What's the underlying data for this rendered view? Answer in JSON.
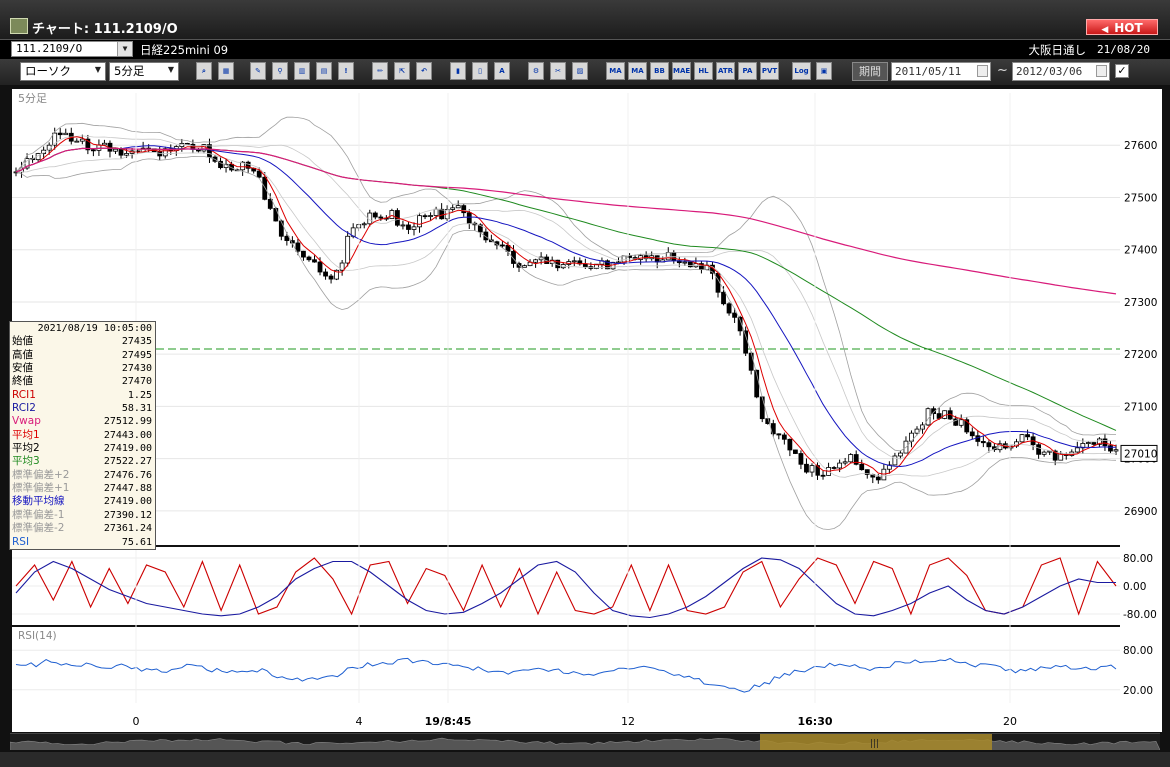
{
  "window": {
    "title": "チャート: 111.2109/O",
    "hot_label": "HOT"
  },
  "symbol": {
    "code": "111.2109/O",
    "name": "日経225mini 09",
    "exchange": "大阪日通し",
    "date": "21/08/20"
  },
  "toolbar": {
    "chart_type": "ローソク",
    "interval": "5分足",
    "icons": [
      "zoom-icon",
      "crosshair-icon",
      "draw-icon",
      "search-icon",
      "bar-chart-icon",
      "pattern-icon",
      "warning-icon",
      "pen-icon",
      "cursor-icon",
      "undo-icon",
      "candle-icon",
      "candle-icon",
      "all-icon",
      "settings-icon",
      "tools-icon",
      "color-icon"
    ],
    "indicator_buttons": [
      "MA",
      "MA",
      "BB",
      "MAE",
      "HL",
      "ATR",
      "PA",
      "PVT",
      "Log"
    ],
    "period_label": "期間",
    "date_from": "2011/05/11",
    "date_to": "2012/03/06",
    "tilde": "~"
  },
  "chart": {
    "interval_label": "5分足",
    "price_labels": [
      "27600",
      "27500",
      "27400",
      "27300",
      "27200",
      "27100",
      "27000",
      "26900"
    ],
    "current_price": "27010",
    "rci_labels": [
      "80.00",
      "0.00",
      "-80.00"
    ],
    "rsi_title": "RSI(14)",
    "rsi_labels": [
      "80.00",
      "20.00"
    ],
    "x_labels": [
      "0",
      "4",
      "19/8:45",
      "12",
      "16:30",
      "20"
    ],
    "colors": {
      "bg": "#ffffff",
      "ma_blue": "#1515c0",
      "ma_red": "#dd0000",
      "vwap": "#d81b7a",
      "ma_long": "#1f8a1f",
      "band": "#a0a0a0",
      "rsi": "#1e5fd0",
      "rci1": "#cc0000",
      "rci2": "#1a1aa0"
    }
  },
  "info_panel": {
    "datetime": "2021/08/19 10:05:00",
    "rows": [
      {
        "label": "始値",
        "value": "27435",
        "color": "#000000"
      },
      {
        "label": "高値",
        "value": "27495",
        "color": "#000000"
      },
      {
        "label": "安値",
        "value": "27430",
        "color": "#000000"
      },
      {
        "label": "終値",
        "value": "27470",
        "color": "#000000"
      },
      {
        "label": "RCI1",
        "value": "1.25",
        "color": "#cc0000"
      },
      {
        "label": "RCI2",
        "value": "58.31",
        "color": "#1a1aa0"
      },
      {
        "label": "Vwap",
        "value": "27512.99",
        "color": "#d81b7a"
      },
      {
        "label": "平均1",
        "value": "27443.00",
        "color": "#dd0000"
      },
      {
        "label": "平均2",
        "value": "27419.00",
        "color": "#000000"
      },
      {
        "label": "平均3",
        "value": "27522.27",
        "color": "#1f8a1f"
      },
      {
        "label": "標準偏差+2",
        "value": "27476.76",
        "color": "#999999"
      },
      {
        "label": "標準偏差+1",
        "value": "27447.88",
        "color": "#999999"
      },
      {
        "label": "移動平均線",
        "value": "27419.00",
        "color": "#1515c0"
      },
      {
        "label": "標準偏差-1",
        "value": "27390.12",
        "color": "#999999"
      },
      {
        "label": "標準偏差-2",
        "value": "27361.24",
        "color": "#999999"
      },
      {
        "label": "RSI",
        "value": "75.61",
        "color": "#1e5fd0"
      }
    ]
  },
  "chart_data": {
    "type": "candlestick",
    "interval": "5分足",
    "ylim": [
      26850,
      27700
    ],
    "dashed_level": 27210,
    "x_ticks": [
      "0",
      "4",
      "19/8:45",
      "12",
      "16:30",
      "20"
    ],
    "close_path": [
      27560,
      27575,
      27620,
      27610,
      27600,
      27600,
      27585,
      27585,
      27590,
      27595,
      27600,
      27550,
      27560,
      27540,
      27440,
      27400,
      27380,
      27330,
      27440,
      27460,
      27470,
      27440,
      27465,
      27470,
      27480,
      27420,
      27400,
      27370,
      27380,
      27370,
      27380,
      27370,
      27375,
      27380,
      27380,
      27390,
      27380,
      27370,
      27300,
      27230,
      27080,
      27040,
      26990,
      26970,
      26990,
      27000,
      26960,
      26990,
      27050,
      27090,
      27080,
      27060,
      27030,
      27020,
      27040,
      27010,
      27000,
      27020,
      27030,
      27010
    ],
    "rsi": {
      "name": "RSI(14)",
      "ylim": [
        0,
        100
      ],
      "values": [
        62,
        58,
        65,
        55,
        60,
        52,
        57,
        50,
        48,
        55,
        53,
        47,
        45,
        50,
        42,
        38,
        35,
        40,
        55,
        58,
        62,
        66,
        60,
        57,
        55,
        50,
        46,
        48,
        52,
        50,
        47,
        45,
        48,
        52,
        55,
        45,
        40,
        30,
        22,
        18,
        28,
        40,
        48,
        55,
        60,
        56,
        52,
        58,
        62,
        66,
        65,
        60,
        56,
        52,
        48,
        52,
        55,
        50,
        53,
        55
      ]
    },
    "rci": {
      "ylim": [
        -100,
        100
      ],
      "rci1": [
        0,
        60,
        -40,
        70,
        -60,
        50,
        -50,
        60,
        40,
        -60,
        70,
        -70,
        60,
        -80,
        -60,
        40,
        80,
        20,
        -80,
        60,
        70,
        -50,
        50,
        30,
        -70,
        60,
        -60,
        50,
        -80,
        40,
        -70,
        -80,
        -60,
        60,
        -70,
        60,
        -70,
        -80,
        -60,
        40,
        70,
        -60,
        20,
        80,
        60,
        -50,
        70,
        50,
        -80,
        60,
        80,
        30,
        -70,
        -80,
        -60,
        60,
        80,
        -80,
        70,
        0
      ],
      "rci2": [
        -20,
        40,
        70,
        50,
        20,
        -10,
        -30,
        -50,
        -60,
        -70,
        -80,
        -85,
        -80,
        -60,
        -30,
        20,
        50,
        70,
        70,
        40,
        0,
        -40,
        -70,
        -80,
        -75,
        -50,
        -20,
        20,
        60,
        70,
        40,
        -20,
        -70,
        -85,
        -90,
        -80,
        -60,
        -30,
        10,
        50,
        80,
        75,
        50,
        0,
        -50,
        -80,
        -85,
        -70,
        -50,
        -20,
        0,
        -40,
        -70,
        -80,
        -60,
        -30,
        0,
        20,
        10,
        10
      ]
    }
  }
}
